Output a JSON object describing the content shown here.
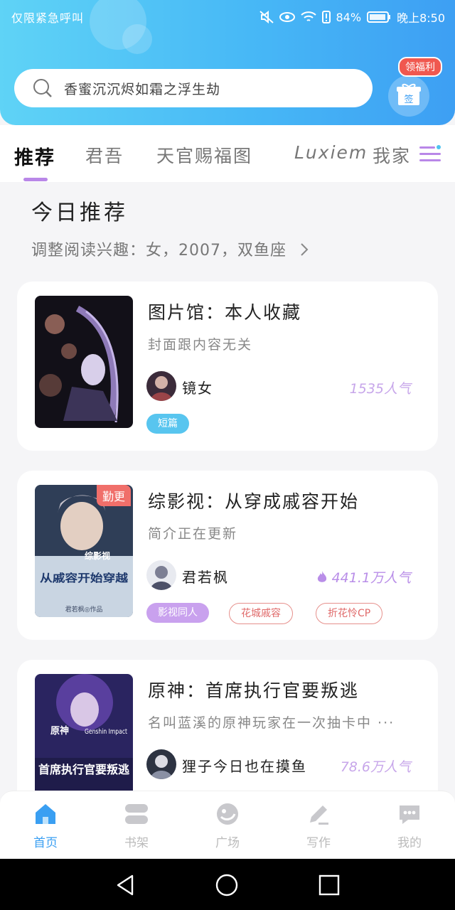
{
  "status_bar": {
    "left_text": "仅限紧急呼叫",
    "battery": "84%",
    "time": "晚上8:50"
  },
  "search": {
    "placeholder": "香蜜沉沉烬如霜之浮生劫"
  },
  "gift": {
    "badge": "领福利",
    "sign_label": "签"
  },
  "tabs": [
    {
      "label": "推荐",
      "active": true
    },
    {
      "label": "君吾"
    },
    {
      "label": "天官赐福图"
    },
    {
      "label": "Luxiem"
    },
    {
      "label": "我家"
    }
  ],
  "section": {
    "title": "今日推荐",
    "subtitle": "调整阅读兴趣：女，2007，双鱼座"
  },
  "books": [
    {
      "title": "图片馆：本人收藏",
      "desc": "封面跟内容无关",
      "author": "镜女",
      "popularity": "1535人气",
      "tags": [
        "短篇"
      ]
    },
    {
      "title": "综影视：从穿成戚容开始",
      "desc": "简介正在更新",
      "author": "君若枫",
      "popularity": "441.1万人气",
      "badge": "勤更",
      "cover_text": "从戚容开始穿越",
      "cover_tag": "综影视",
      "cover_author": "君若枫◎作品",
      "tags": [
        "影视同人",
        "花城戚容",
        "折花怜CP"
      ]
    },
    {
      "title": "原神：首席执行官要叛逃",
      "desc": "名叫蓝溪的原神玩家在一次抽卡中 ···",
      "author": "狸子今日也在摸鱼",
      "popularity": "78.6万人气",
      "cover_text": "首席执行官要叛逃",
      "cover_tag": "原神",
      "cover_sub": "Genshin Impact",
      "tags": []
    }
  ],
  "bottom_nav": [
    {
      "label": "首页",
      "icon": "home-icon",
      "active": true
    },
    {
      "label": "书架",
      "icon": "bookshelf-icon"
    },
    {
      "label": "广场",
      "icon": "plaza-icon"
    },
    {
      "label": "写作",
      "icon": "write-icon"
    },
    {
      "label": "我的",
      "icon": "profile-icon"
    }
  ],
  "colors": {
    "accent": "#3a9ff2",
    "tab_indicator": "#b987e8",
    "popularity": "#c7a6ea",
    "badge": "#f0584f"
  }
}
